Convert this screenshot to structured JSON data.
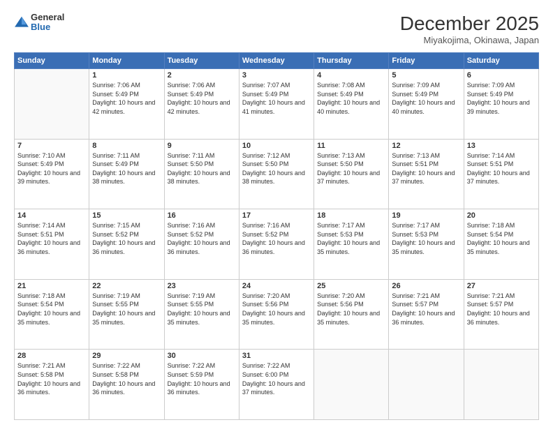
{
  "header": {
    "logo": {
      "general": "General",
      "blue": "Blue"
    },
    "title": "December 2025",
    "location": "Miyakojima, Okinawa, Japan"
  },
  "weekdays": [
    "Sunday",
    "Monday",
    "Tuesday",
    "Wednesday",
    "Thursday",
    "Friday",
    "Saturday"
  ],
  "weeks": [
    [
      {
        "day": "",
        "info": ""
      },
      {
        "day": "1",
        "info": "Sunrise: 7:06 AM\nSunset: 5:49 PM\nDaylight: 10 hours\nand 42 minutes."
      },
      {
        "day": "2",
        "info": "Sunrise: 7:06 AM\nSunset: 5:49 PM\nDaylight: 10 hours\nand 42 minutes."
      },
      {
        "day": "3",
        "info": "Sunrise: 7:07 AM\nSunset: 5:49 PM\nDaylight: 10 hours\nand 41 minutes."
      },
      {
        "day": "4",
        "info": "Sunrise: 7:08 AM\nSunset: 5:49 PM\nDaylight: 10 hours\nand 40 minutes."
      },
      {
        "day": "5",
        "info": "Sunrise: 7:09 AM\nSunset: 5:49 PM\nDaylight: 10 hours\nand 40 minutes."
      },
      {
        "day": "6",
        "info": "Sunrise: 7:09 AM\nSunset: 5:49 PM\nDaylight: 10 hours\nand 39 minutes."
      }
    ],
    [
      {
        "day": "7",
        "info": "Sunrise: 7:10 AM\nSunset: 5:49 PM\nDaylight: 10 hours\nand 39 minutes."
      },
      {
        "day": "8",
        "info": "Sunrise: 7:11 AM\nSunset: 5:49 PM\nDaylight: 10 hours\nand 38 minutes."
      },
      {
        "day": "9",
        "info": "Sunrise: 7:11 AM\nSunset: 5:50 PM\nDaylight: 10 hours\nand 38 minutes."
      },
      {
        "day": "10",
        "info": "Sunrise: 7:12 AM\nSunset: 5:50 PM\nDaylight: 10 hours\nand 38 minutes."
      },
      {
        "day": "11",
        "info": "Sunrise: 7:13 AM\nSunset: 5:50 PM\nDaylight: 10 hours\nand 37 minutes."
      },
      {
        "day": "12",
        "info": "Sunrise: 7:13 AM\nSunset: 5:51 PM\nDaylight: 10 hours\nand 37 minutes."
      },
      {
        "day": "13",
        "info": "Sunrise: 7:14 AM\nSunset: 5:51 PM\nDaylight: 10 hours\nand 37 minutes."
      }
    ],
    [
      {
        "day": "14",
        "info": "Sunrise: 7:14 AM\nSunset: 5:51 PM\nDaylight: 10 hours\nand 36 minutes."
      },
      {
        "day": "15",
        "info": "Sunrise: 7:15 AM\nSunset: 5:52 PM\nDaylight: 10 hours\nand 36 minutes."
      },
      {
        "day": "16",
        "info": "Sunrise: 7:16 AM\nSunset: 5:52 PM\nDaylight: 10 hours\nand 36 minutes."
      },
      {
        "day": "17",
        "info": "Sunrise: 7:16 AM\nSunset: 5:52 PM\nDaylight: 10 hours\nand 36 minutes."
      },
      {
        "day": "18",
        "info": "Sunrise: 7:17 AM\nSunset: 5:53 PM\nDaylight: 10 hours\nand 35 minutes."
      },
      {
        "day": "19",
        "info": "Sunrise: 7:17 AM\nSunset: 5:53 PM\nDaylight: 10 hours\nand 35 minutes."
      },
      {
        "day": "20",
        "info": "Sunrise: 7:18 AM\nSunset: 5:54 PM\nDaylight: 10 hours\nand 35 minutes."
      }
    ],
    [
      {
        "day": "21",
        "info": "Sunrise: 7:18 AM\nSunset: 5:54 PM\nDaylight: 10 hours\nand 35 minutes."
      },
      {
        "day": "22",
        "info": "Sunrise: 7:19 AM\nSunset: 5:55 PM\nDaylight: 10 hours\nand 35 minutes."
      },
      {
        "day": "23",
        "info": "Sunrise: 7:19 AM\nSunset: 5:55 PM\nDaylight: 10 hours\nand 35 minutes."
      },
      {
        "day": "24",
        "info": "Sunrise: 7:20 AM\nSunset: 5:56 PM\nDaylight: 10 hours\nand 35 minutes."
      },
      {
        "day": "25",
        "info": "Sunrise: 7:20 AM\nSunset: 5:56 PM\nDaylight: 10 hours\nand 35 minutes."
      },
      {
        "day": "26",
        "info": "Sunrise: 7:21 AM\nSunset: 5:57 PM\nDaylight: 10 hours\nand 36 minutes."
      },
      {
        "day": "27",
        "info": "Sunrise: 7:21 AM\nSunset: 5:57 PM\nDaylight: 10 hours\nand 36 minutes."
      }
    ],
    [
      {
        "day": "28",
        "info": "Sunrise: 7:21 AM\nSunset: 5:58 PM\nDaylight: 10 hours\nand 36 minutes."
      },
      {
        "day": "29",
        "info": "Sunrise: 7:22 AM\nSunset: 5:58 PM\nDaylight: 10 hours\nand 36 minutes."
      },
      {
        "day": "30",
        "info": "Sunrise: 7:22 AM\nSunset: 5:59 PM\nDaylight: 10 hours\nand 36 minutes."
      },
      {
        "day": "31",
        "info": "Sunrise: 7:22 AM\nSunset: 6:00 PM\nDaylight: 10 hours\nand 37 minutes."
      },
      {
        "day": "",
        "info": ""
      },
      {
        "day": "",
        "info": ""
      },
      {
        "day": "",
        "info": ""
      }
    ]
  ]
}
